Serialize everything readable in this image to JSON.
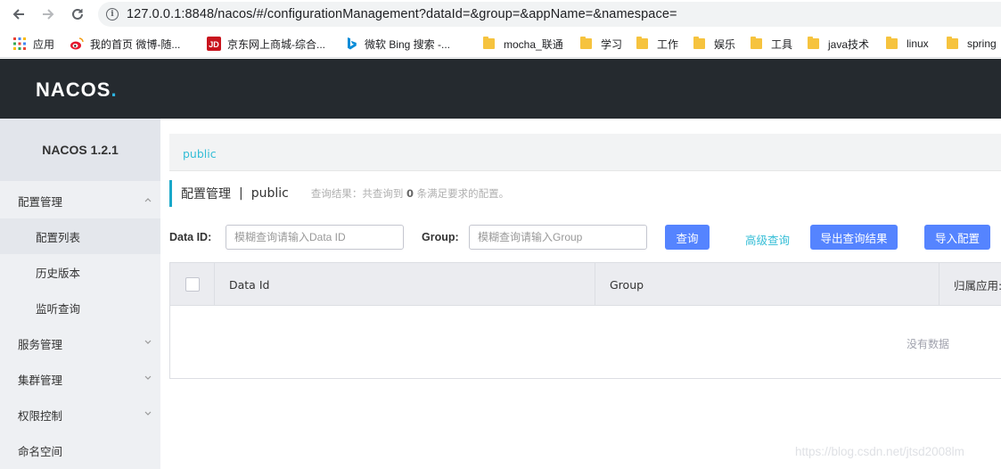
{
  "browser": {
    "url": "127.0.0.1:8848/nacos/#/configurationManagement?dataId=&group=&appName=&namespace=",
    "bookmarks": [
      {
        "label": "应用",
        "icon": "apps-grid-icon"
      },
      {
        "label": "我的首页 微博-随...",
        "icon": "weibo-icon"
      },
      {
        "label": "京东网上商城-综合...",
        "icon": "jd-icon"
      },
      {
        "label": "微软 Bing 搜索 -...",
        "icon": "bing-icon"
      },
      {
        "label": "mocha_联通",
        "icon": "folder-icon"
      },
      {
        "label": "学习",
        "icon": "folder-icon"
      },
      {
        "label": "工作",
        "icon": "folder-icon"
      },
      {
        "label": "娱乐",
        "icon": "folder-icon"
      },
      {
        "label": "工具",
        "icon": "folder-icon"
      },
      {
        "label": "java技术",
        "icon": "folder-icon"
      },
      {
        "label": "linux",
        "icon": "folder-icon"
      },
      {
        "label": "spring",
        "icon": "folder-icon"
      }
    ]
  },
  "header": {
    "logo": "NACOS",
    "logo_dot": "."
  },
  "sidebar": {
    "version": "NACOS 1.2.1",
    "menu": [
      {
        "label": "配置管理",
        "expanded": true
      },
      {
        "label": "配置列表",
        "sub": true,
        "active": true
      },
      {
        "label": "历史版本",
        "sub": true
      },
      {
        "label": "监听查询",
        "sub": true
      },
      {
        "label": "服务管理",
        "expanded": false
      },
      {
        "label": "集群管理",
        "expanded": false
      },
      {
        "label": "权限控制",
        "expanded": false
      },
      {
        "label": "命名空间"
      }
    ]
  },
  "main": {
    "namespace_tab": "public",
    "title": "配置管理",
    "title_sep": "|",
    "namespace": "public",
    "summary_prefix": "查询结果：共查询到",
    "summary_count": "0",
    "summary_suffix": "条满足要求的配置。",
    "form": {
      "dataid_label": "Data ID:",
      "dataid_placeholder": "模糊查询请输入Data ID",
      "group_label": "Group:",
      "group_placeholder": "模糊查询请输入Group",
      "search_button": "查询",
      "advanced_link": "高级查询",
      "export_button": "导出查询结果",
      "import_button": "导入配置"
    },
    "table": {
      "columns": [
        "Data Id",
        "Group",
        "归属应用:"
      ],
      "empty_text": "没有数据"
    }
  },
  "watermark": "https://blog.csdn.net/jtsd2008lm",
  "colors": {
    "header_bg": "#252a2f",
    "accent": "#5584ff",
    "link": "#33bdd6"
  }
}
